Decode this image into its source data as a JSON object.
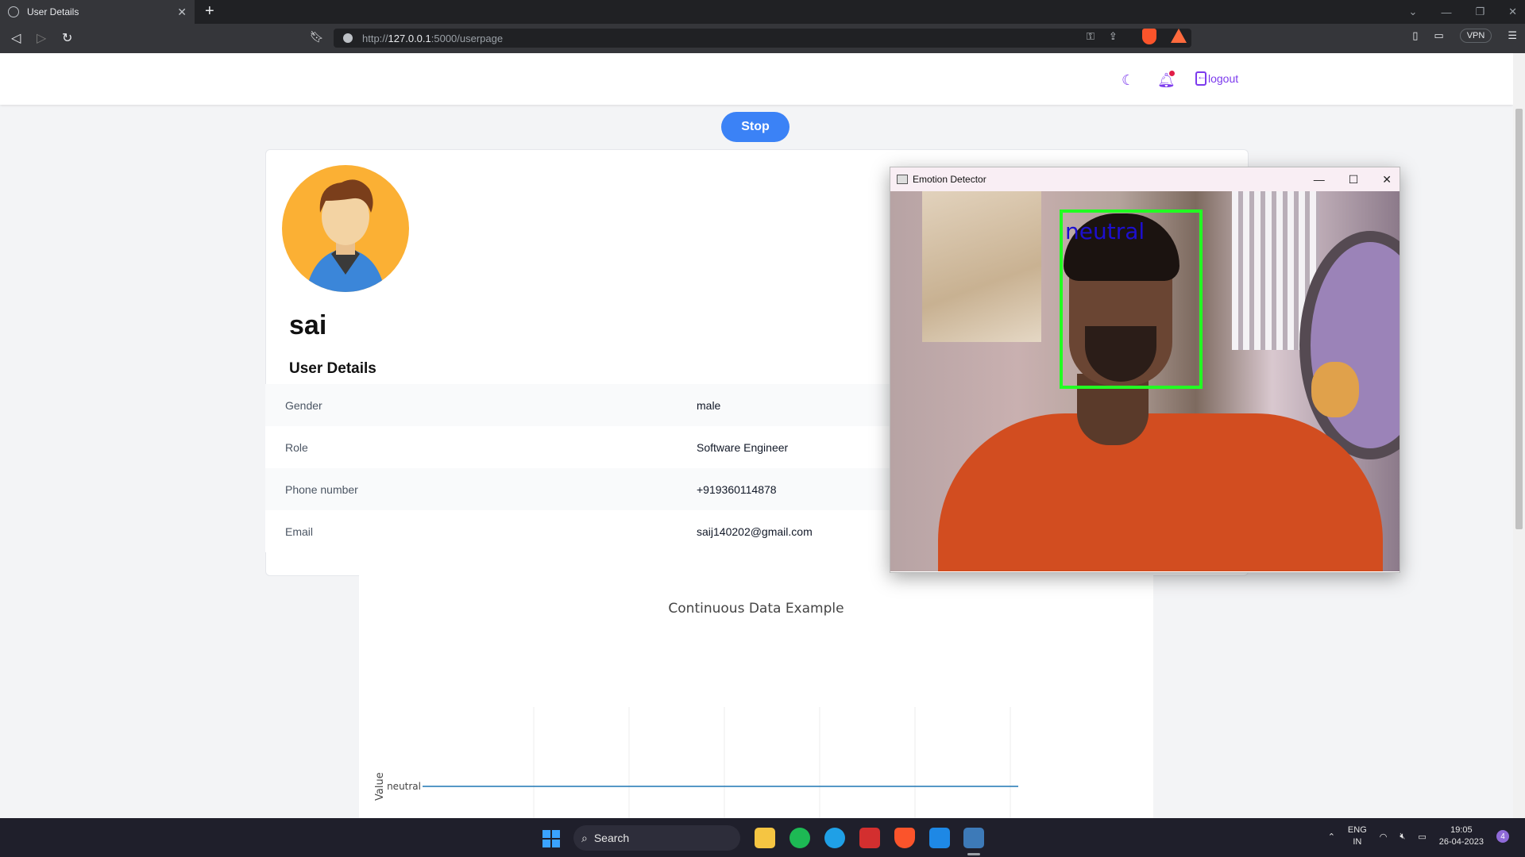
{
  "browser": {
    "tab_title": "User Details",
    "url_prefix": "http://",
    "url_host": "127.0.0.1",
    "url_path": ":5000/userpage",
    "vpn_label": "VPN"
  },
  "header": {
    "logout_label": "logout"
  },
  "main": {
    "stop_label": "Stop",
    "username": "sai",
    "section_title": "User Details",
    "details": [
      {
        "key": "Gender",
        "value": "male"
      },
      {
        "key": "Role",
        "value": "Software Engineer"
      },
      {
        "key": "Phone number",
        "value": "+919360114878"
      },
      {
        "key": "Email",
        "value": "saij140202@gmail.com"
      }
    ]
  },
  "chart_data": {
    "type": "line",
    "title": "Continuous Data Example",
    "ylabel": "Value",
    "xlabel": "",
    "y_categories": [
      "neutral"
    ],
    "series": [
      {
        "values": [
          "neutral",
          "neutral",
          "neutral",
          "neutral",
          "neutral",
          "neutral",
          "neutral"
        ]
      }
    ],
    "grid": true,
    "line_color": "#1f77b4"
  },
  "emotion_window": {
    "title": "Emotion Detector",
    "detected_emotion": "neutral",
    "box_color": "#22ff22",
    "label_color": "#1d0fcf"
  },
  "taskbar": {
    "search_label": "Search",
    "lang_top": "ENG",
    "lang_bottom": "IN",
    "time": "19:05",
    "date": "26-04-2023",
    "notification_count": "4"
  }
}
